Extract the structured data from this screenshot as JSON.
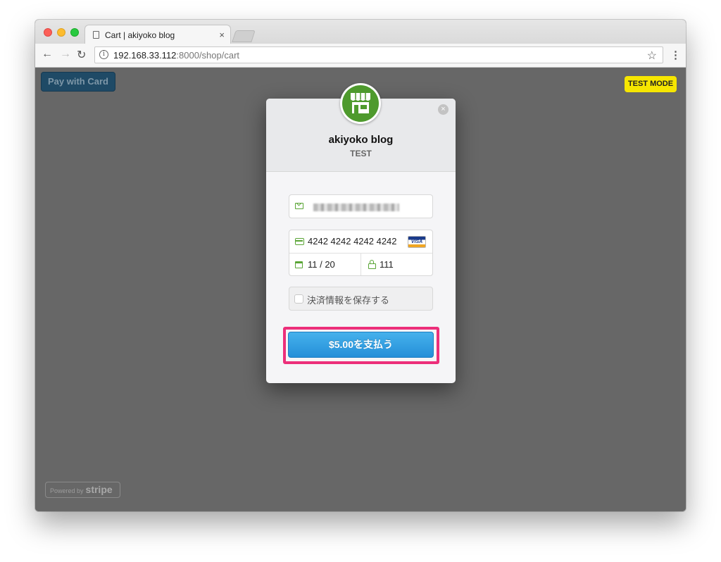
{
  "browser": {
    "tab_title": "Cart | akiyoko blog",
    "tab_close": "×",
    "url_host": "192.168.33.112",
    "url_rest": ":8000/shop/cart",
    "info_glyph": "i"
  },
  "page": {
    "pay_with_card": "Pay with Card",
    "test_mode": "TEST MODE",
    "powered_by": "Powered by",
    "powered_brand": "stripe"
  },
  "checkout": {
    "shop_name": "akiyoko blog",
    "mode_label": "TEST",
    "close_glyph": "×",
    "card_number": "4242 4242 4242 4242",
    "card_brand": "VISA",
    "expiry": "11 / 20",
    "cvc": "111",
    "remember_label": "決済情報を保存する",
    "pay_button": "$5.00を支払う"
  },
  "colors": {
    "overlay": "#676767",
    "accent": "#258fd8",
    "highlight": "#ec2f7a",
    "test_mode": "#f6e600",
    "logo": "#4e9a2d"
  },
  "icons": [
    "document-icon",
    "back-arrow-icon",
    "forward-arrow-icon",
    "reload-icon",
    "info-icon",
    "star-icon",
    "menu-icon",
    "store-icon",
    "close-icon",
    "mail-icon",
    "card-icon",
    "calendar-icon",
    "lock-icon",
    "visa-logo"
  ]
}
